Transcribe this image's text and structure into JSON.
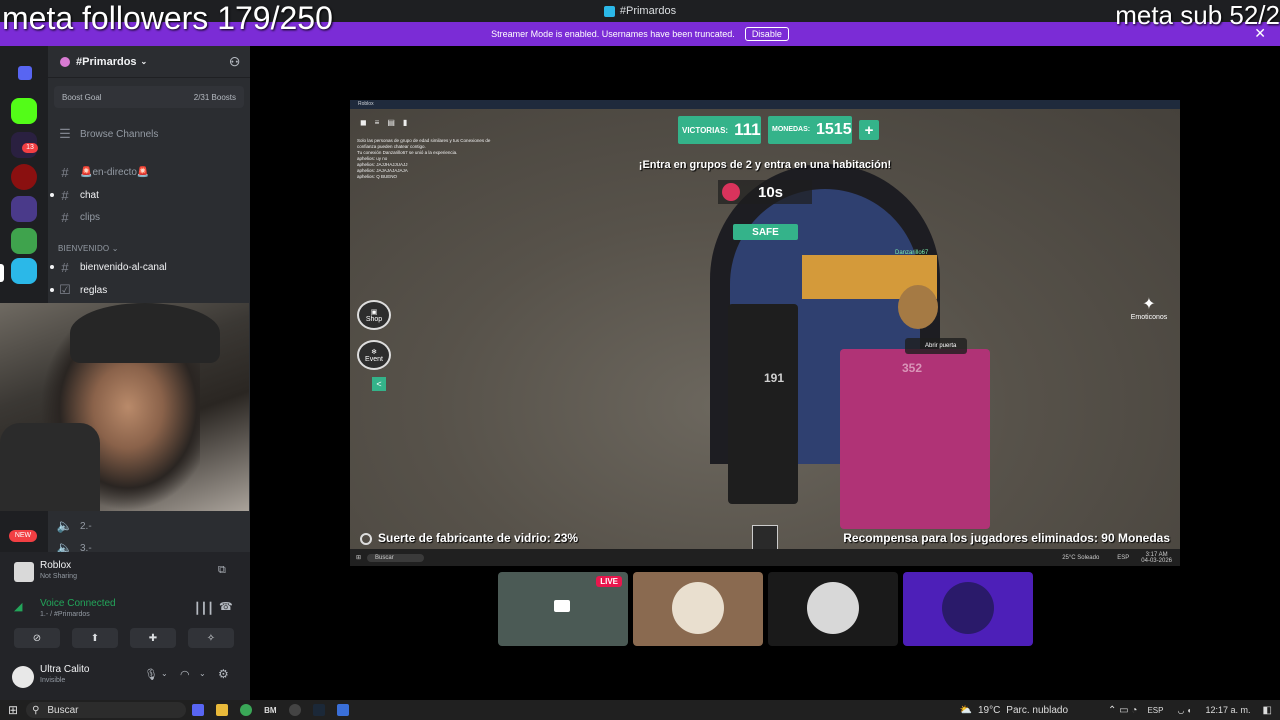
{
  "window": {
    "title": "#Primardos"
  },
  "banner": {
    "text": "Streamer Mode is enabled. Usernames have been truncated.",
    "disable_label": "Disable"
  },
  "overlay": {
    "meta_followers": "meta followers 179/250",
    "meta_sub": "meta sub 52/2"
  },
  "rail": {
    "badge_count": "13",
    "new_badge": "NEW"
  },
  "sidebar": {
    "server_name": "#Primardos",
    "boost_goal_label": "Boost Goal",
    "boost_count": "2/31 Boosts",
    "browse_channels": "Browse Channels",
    "channels": [
      {
        "name": "en-directo",
        "emoji": "🚨"
      },
      {
        "name": "chat"
      },
      {
        "name": "clips"
      }
    ],
    "category": "BIENVENIDO",
    "category_channels": [
      {
        "name": "bienvenido-al-canal"
      },
      {
        "name": "reglas"
      }
    ],
    "voice_channels": [
      "2.-",
      "3.-"
    ]
  },
  "panel": {
    "app_name": "Roblox",
    "app_status": "Not Sharing",
    "voice_status": "Voice Connected",
    "voice_channel": "1.- / #Primardos",
    "user_name": "Ultra Calito",
    "user_status": "Invisible"
  },
  "game": {
    "window_title": "Roblox",
    "victorias_label": "VICTORIAS:",
    "victorias_value": "111",
    "monedas_label": "MONEDAS:",
    "monedas_value": "1515",
    "plus": "+",
    "instruction": "¡Entra en grupos de 2 y entra en una habitación!",
    "timer": "10s",
    "safe": "SAFE",
    "player_name": "Danzarillo67",
    "prompt": "Abrir puerta",
    "shirt_number_1": "191",
    "shirt_number_2": "352",
    "shop_label": "Shop",
    "event_label": "Event",
    "emotes_label": "Emoticonos",
    "luck_text": "Suerte de fabricante de vidrio: 23%",
    "reward_text": "Recompensa para los jugadores eliminados: 90 Monedas",
    "chat_lines": [
      "Solo las personas de grupo de edad similares y tus Conexiones de",
      "confianza pueden chatear contigo.",
      "Tu conexión Danzarillo67 se unió a la experiencia.",
      "aphelios: uy no",
      "aphelios: JAJJHAJJUAJJ",
      "aphelios: JAJAJAJAJAJA",
      "aphelios: Q BUENO"
    ],
    "inner_taskbar": {
      "search": "Buscar",
      "weather": "25°C Soleado",
      "lang": "ESP",
      "time": "3:17 AM",
      "date": "04-03-2026"
    }
  },
  "thumbnails": {
    "live_badge": "LIVE"
  },
  "taskbar": {
    "search_placeholder": "Buscar",
    "weather_temp": "19°C",
    "weather_desc": "Parc. nublado",
    "lang": "ESP",
    "time": "12:17 a. m.",
    "bm_label": "BM"
  },
  "colors": {
    "banner": "#7b2cd6",
    "hud_green": "#34b38a",
    "voice_green": "#23a55a",
    "discord_sidebar": "#2b2d31"
  }
}
